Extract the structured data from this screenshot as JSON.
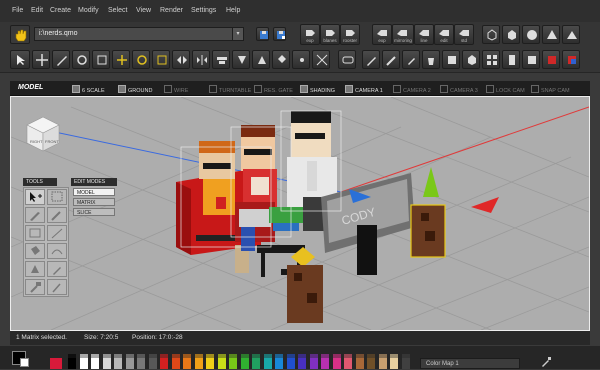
{
  "menu": [
    "File",
    "Edit",
    "Create",
    "Modify",
    "Select",
    "View",
    "Render",
    "Settings",
    "Help"
  ],
  "file": {
    "path": "i:\\nerds.qmo",
    "dropdown": "▾"
  },
  "toolbar1": {
    "captions": [
      "exp",
      "blanes",
      "rooster",
      "exp",
      "mirroring",
      "line",
      "edit",
      "std"
    ]
  },
  "modebar": {
    "title": "MODEL",
    "toggles": [
      {
        "label": "6 SCALE",
        "active": true
      },
      {
        "label": "GROUND",
        "active": true
      },
      {
        "label": "WIRE",
        "active": false
      },
      {
        "label": "TURNTABLE",
        "active": false
      },
      {
        "label": "RES. GATE",
        "active": false
      },
      {
        "label": "SHADING",
        "active": true
      },
      {
        "label": "CAMERA 1",
        "active": true
      },
      {
        "label": "CAMERA 2",
        "active": false
      },
      {
        "label": "CAMERA 3",
        "active": false
      },
      {
        "label": "LOCK CAM",
        "active": false
      },
      {
        "label": "SNAP CAM",
        "active": false
      }
    ]
  },
  "viewcube": {
    "top": "",
    "right": "RIGHT",
    "front": "FRONT"
  },
  "tools": {
    "header": "TOOLS"
  },
  "edit_modes": {
    "header": "EDIT MODES",
    "items": [
      "MODEL",
      "MATRIX",
      "SLICE"
    ],
    "selected": "MODEL"
  },
  "scene_text": {
    "monitor": "CODY"
  },
  "status": {
    "selection": "1 Matrix selected.",
    "size": "Size: 7:20:5",
    "position": "Position: 17:0:-28"
  },
  "palette": {
    "colors": [
      "#000000",
      "#ffffff",
      "#ffffff",
      "#d8d8d8",
      "#b8b8b8",
      "#989898",
      "#787878",
      "#585858",
      "#d22020",
      "#e04818",
      "#e87818",
      "#f0a018",
      "#f0d018",
      "#c8e018",
      "#78c818",
      "#30b030",
      "#20a060",
      "#18a8a8",
      "#1888d8",
      "#2050d0",
      "#4830c0",
      "#8030c0",
      "#b830b0",
      "#d83088",
      "#e05870",
      "#a86838",
      "#705028",
      "#c8a070",
      "#e8d0a0",
      "#404040"
    ],
    "active_fg": "#000000",
    "active_bg": "#ffffff",
    "color_map": "Color Map 1"
  }
}
